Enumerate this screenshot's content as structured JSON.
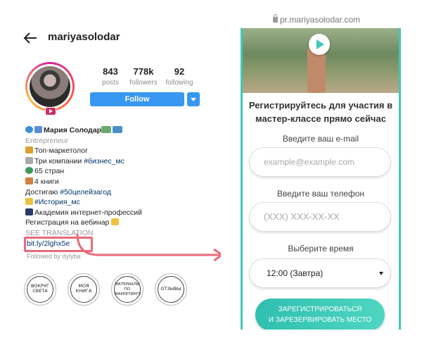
{
  "instagram": {
    "username": "mariyasolodar",
    "stats": [
      {
        "value": "843",
        "label": "posts"
      },
      {
        "value": "778k",
        "label": "followers"
      },
      {
        "value": "92",
        "label": "following"
      }
    ],
    "follow_label": "Follow",
    "bio": {
      "name": "Мария Солодар",
      "category": "Entrepreneur",
      "lines": [
        "Топ-маркетолог",
        "Три компании ",
        "65 стран",
        "4 книги",
        " Достигаю ",
        "#История_мс",
        "Академия интернет-профессий",
        "Регистрация на вебинар"
      ],
      "hashtag_business": "#бизнес_мс",
      "hashtag_goals": "#50целейзагод",
      "see_translation": "SEE TRANSLATION",
      "link": "bit.ly/2lghx5e",
      "followed_by": "Followed by dylyba"
    },
    "highlights": [
      {
        "text": "ВОКРУГ СВЕТА"
      },
      {
        "text": "МОЯ КНИГА"
      },
      {
        "text": "МАТЕРИАЛЫ ПО МАРКЕТИНГУ"
      },
      {
        "text": "ОТЗЫВЫ"
      }
    ],
    "colors": {
      "follow": "#3897f0",
      "highlight_box": "#e86b7c"
    }
  },
  "landing": {
    "url": "pr.mariyasolodar.com",
    "heading": "Регистрируйтесь для участия в мастер-классе прямо сейчас",
    "email_label": "Введите ваш e-mail",
    "email_placeholder": "example@example.com",
    "phone_label": "Введите ваш телефон",
    "phone_placeholder": "(XXX) XXX-XX-XX",
    "time_label": "Выберите время",
    "time_value": "12:00 (Завтра)",
    "register_label_1": "ЗАРЕГИСТРИРОВАТЬСЯ",
    "register_label_2": "И ЗАРЕЗЕРВИРОВАТЬ МЕСТО",
    "colors": {
      "accent": "#3ec9b8"
    }
  }
}
